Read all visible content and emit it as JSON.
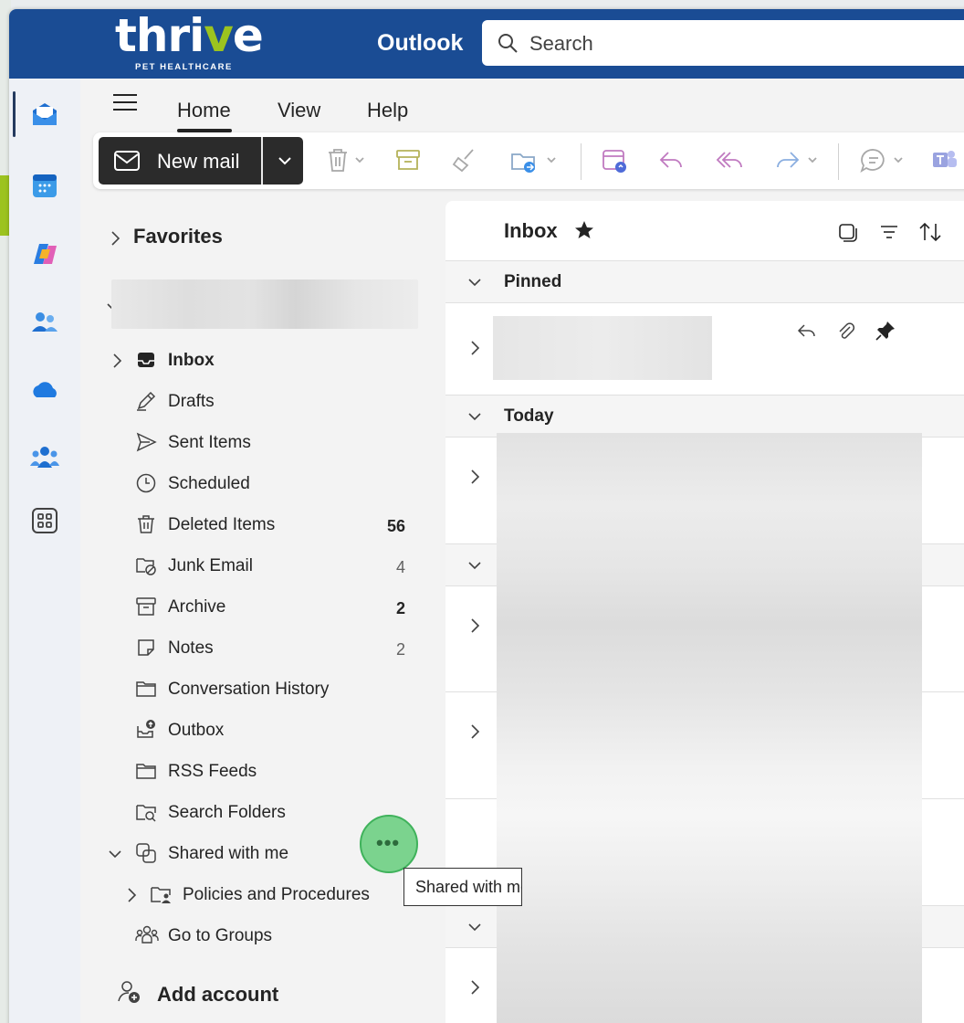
{
  "header": {
    "brand_word_a": "thri",
    "brand_word_v": "v",
    "brand_word_b": "e",
    "brand_sub": "PET HEALTHCARE",
    "app_title": "Outlook",
    "search_placeholder": "Search"
  },
  "rail": {
    "apps": [
      "mail-icon",
      "calendar-icon",
      "copilot-icon",
      "people-icon",
      "onedrive-icon",
      "teams-groups-icon",
      "more-apps-icon"
    ]
  },
  "ribbon": {
    "tabs": [
      "Home",
      "View",
      "Help"
    ],
    "active_tab": "Home"
  },
  "toolbar": {
    "new_mail_label": "New mail"
  },
  "folders": {
    "favorites_label": "Favorites",
    "items": [
      {
        "label": "Inbox",
        "count": "",
        "bold": true
      },
      {
        "label": "Drafts",
        "count": ""
      },
      {
        "label": "Sent Items",
        "count": ""
      },
      {
        "label": "Scheduled",
        "count": ""
      },
      {
        "label": "Deleted Items",
        "count": "56",
        "bold_count": true
      },
      {
        "label": "Junk Email",
        "count": "4"
      },
      {
        "label": "Archive",
        "count": "2",
        "bold_count": true
      },
      {
        "label": "Notes",
        "count": "2"
      },
      {
        "label": "Conversation History",
        "count": ""
      },
      {
        "label": "Outbox",
        "count": ""
      },
      {
        "label": "RSS Feeds",
        "count": ""
      },
      {
        "label": "Search Folders",
        "count": ""
      },
      {
        "label": "Shared with me",
        "count": ""
      },
      {
        "label": "Policies and Procedures",
        "count": ""
      },
      {
        "label": "Go to Groups",
        "count": ""
      }
    ],
    "more_label": "•••",
    "tooltip": "Shared with me",
    "add_account_label": "Add account"
  },
  "message_list": {
    "title": "Inbox",
    "groups": {
      "pinned": "Pinned",
      "today": "Today"
    }
  }
}
